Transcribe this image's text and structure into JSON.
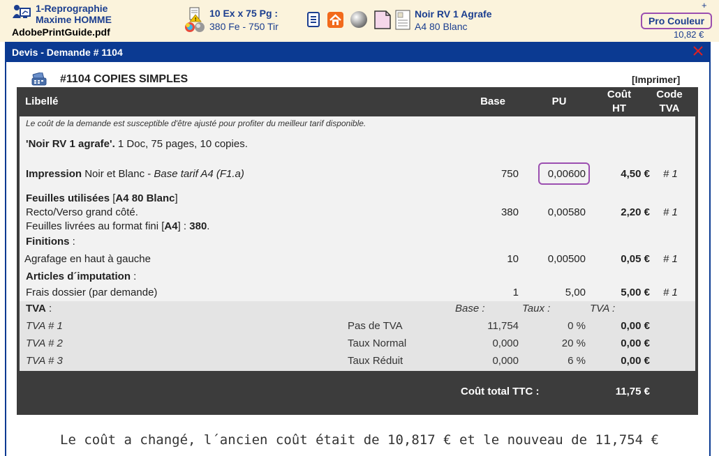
{
  "topbar": {
    "job_line1": "1-Reprographie",
    "job_line2": "Maxime HOMME",
    "file_name": "AdobePrintGuide.pdf",
    "quantity": "10 Ex x 75 Pg :",
    "sheets": "380 Fe - 750 Tir",
    "product_name": "Noir RV 1 Agrafe",
    "product_paper": "A4 80 Blanc",
    "plus": "+",
    "pro_label": "Pro Couleur",
    "price": "10,82 €"
  },
  "dialog": {
    "title": "Devis - Demande # 1104",
    "section_title": "#1104 COPIES SIMPLES",
    "print_link": "[Imprimer]"
  },
  "table": {
    "headers": {
      "libelle": "Libellé",
      "base": "Base",
      "pu": "PU",
      "cout_l1": "Coût",
      "cout_l2": "HT",
      "code_l1": "Code",
      "code_l2": "TVA"
    },
    "note": "Le coût de la demande est susceptible d'être ajusté pour profiter du meilleur tarif disponible.",
    "summary_bold": "'Noir RV 1 agrafe'.",
    "summary_rest": " 1 Doc, 75 pages, 10 copies.",
    "impression": {
      "label_bold": "Impression",
      "label_rest": " Noir et Blanc - ",
      "label_italic": "Base tarif A4  (F1.a)",
      "base": "750",
      "pu": "0,00600",
      "cout": "4,50 €",
      "code": "# 1"
    },
    "feuilles": {
      "label_bold1": "Feuilles utilisées",
      "bracket_open": " [",
      "label_bold2": "A4 80 Blanc",
      "bracket_close": "]",
      "line2": "Recto/Verso grand côté.",
      "line3_a": "Feuilles livrées au format fini [",
      "line3_b": "A4",
      "line3_c": "] : ",
      "line3_d": "380",
      "line3_e": ".",
      "base": "380",
      "pu": "0,00580",
      "cout": "2,20 €",
      "code": "# 1"
    },
    "finitions": {
      "title": "Finitions",
      "colon": " :",
      "label": "Agrafage en haut à gauche",
      "base": "10",
      "pu": "0,00500",
      "cout": "0,05 €",
      "code": "# 1"
    },
    "articles": {
      "title": "Articles d´imputation",
      "colon": " :",
      "label": "Frais dossier (par demande)",
      "base": "1",
      "pu": "5,00",
      "cout": "5,00 €",
      "code": "# 1"
    },
    "tva": {
      "title": "TVA",
      "colon": " :",
      "col_base": "Base :",
      "col_taux": "Taux :",
      "col_tva": "TVA :",
      "rows": [
        {
          "code": "TVA # 1",
          "label": "Pas de TVA",
          "base": "11,754",
          "taux": "0 %",
          "tva": "0,00 €"
        },
        {
          "code": "TVA # 2",
          "label": "Taux Normal",
          "base": "0,000",
          "taux": "20 %",
          "tva": "0,00 €"
        },
        {
          "code": "TVA # 3",
          "label": "Taux Réduit",
          "base": "0,000",
          "taux": "6 %",
          "tva": "0,00 €"
        }
      ]
    },
    "total_label": "Coût total TTC :",
    "total_value": "11,75 €"
  },
  "message": "Le coût a changé, l´ancien coût était de 10,817 € et le nouveau de 11,754 €",
  "colors": {
    "accent_blue": "#0b3a92",
    "highlight_purple": "#9b4fb0",
    "topbar_bg": "#fbf3dc",
    "table_dark": "#3c3c3c"
  }
}
